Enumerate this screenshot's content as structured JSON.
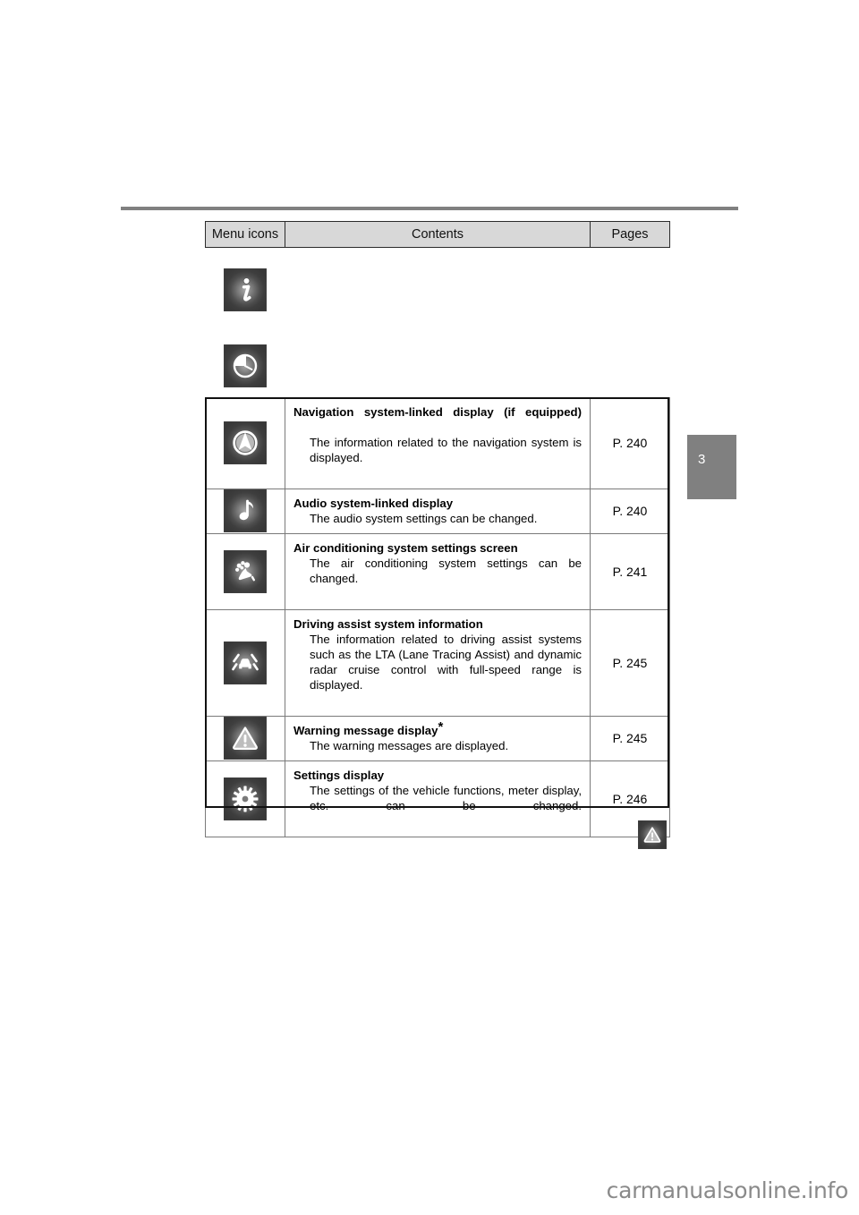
{
  "page": {
    "chapter_tab": "3",
    "watermark": "carmanualsonline.info"
  },
  "table": {
    "headers": {
      "icons": "Menu icons",
      "contents": "Contents",
      "pages": "Pages"
    },
    "floating_icons": [
      {
        "icon": "info-icon",
        "name": "information-display-icon"
      },
      {
        "icon": "clock-icon",
        "name": "trip-information-icon"
      }
    ],
    "rows": [
      {
        "icon": "navigation-compass-icon",
        "title": "Navigation system-linked display (if equipped)",
        "description": "The information related to the navigation system is displayed.",
        "page": "P. 240",
        "asterisk": ""
      },
      {
        "icon": "music-note-icon",
        "title": "Audio system-linked display",
        "description": "The audio system settings can be changed.",
        "page": "P. 240",
        "asterisk": ""
      },
      {
        "icon": "air-conditioning-icon",
        "title": "Air conditioning system settings screen",
        "description": "The air conditioning system settings can be changed.",
        "page": "P. 241",
        "asterisk": ""
      },
      {
        "icon": "lane-tracing-assist-icon",
        "title": "Driving assist system information",
        "description": "The information related to driving assist systems such as the LTA (Lane Tracing Assist) and dynamic radar cruise control with full-speed range is displayed.",
        "page": "P. 245",
        "asterisk": ""
      },
      {
        "icon": "warning-triangle-icon",
        "title": "Warning message display",
        "description": "The warning messages are displayed.",
        "page": "P. 245",
        "asterisk": "*"
      },
      {
        "icon": "gear-settings-icon",
        "title": "Settings display",
        "description": "The settings of the vehicle functions, meter display, etc. can be changed.",
        "page": "P. 246",
        "asterisk": ""
      }
    ]
  },
  "colors": {
    "rule": "#808080",
    "header_bg": "#d8d8d8",
    "tab_bg": "#808080",
    "icon_tile": "#3e3e3e",
    "watermark": "#8a8a8a"
  }
}
